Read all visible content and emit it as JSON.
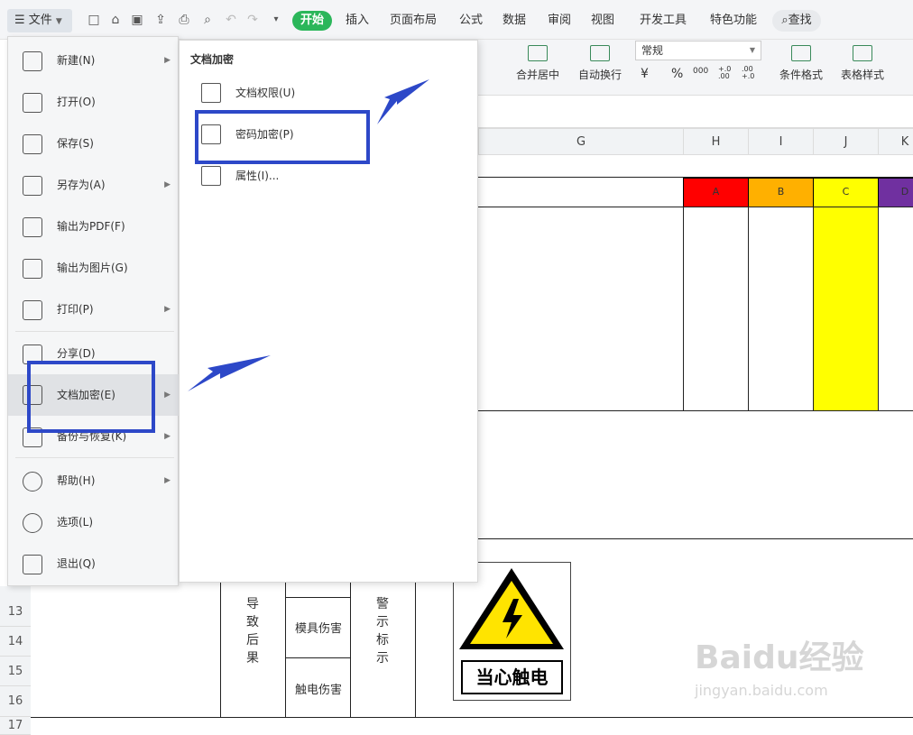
{
  "toolbar": {
    "file_label": "文件",
    "tabs": [
      "开始",
      "插入",
      "页面布局",
      "公式",
      "数据",
      "审阅",
      "视图",
      "开发工具",
      "特色功能"
    ],
    "search_label": "查找"
  },
  "ribbon": {
    "merge_label": "合并居中",
    "wrap_label": "自动换行",
    "number_format": "常规",
    "currency_symbol": "¥",
    "percent_symbol": "%",
    "thousands": "000",
    "dec_up": "+.0 .00",
    "dec_down": ".00 +.0",
    "cond_format": "条件格式",
    "table_style": "表格样式"
  },
  "file_menu": {
    "items": [
      {
        "label": "新建(N)",
        "icon": "new-file-icon",
        "arrow": true
      },
      {
        "label": "打开(O)",
        "icon": "folder-open-icon",
        "arrow": false
      },
      {
        "label": "保存(S)",
        "icon": "save-icon",
        "arrow": false
      },
      {
        "label": "另存为(A)",
        "icon": "save-as-icon",
        "arrow": true
      },
      {
        "label": "输出为PDF(F)",
        "icon": "pdf-export-icon",
        "arrow": false
      },
      {
        "label": "输出为图片(G)",
        "icon": "image-export-icon",
        "arrow": false
      },
      {
        "label": "打印(P)",
        "icon": "print-icon",
        "arrow": true
      },
      {
        "label": "分享(D)",
        "icon": "share-icon",
        "arrow": false
      },
      {
        "label": "文档加密(E)",
        "icon": "document-encrypt-icon",
        "arrow": true
      },
      {
        "label": "备份与恢复(K)",
        "icon": "backup-icon",
        "arrow": true
      },
      {
        "label": "帮助(H)",
        "icon": "help-icon",
        "arrow": true
      },
      {
        "label": "选项(L)",
        "icon": "gear-icon",
        "arrow": false
      },
      {
        "label": "退出(Q)",
        "icon": "exit-icon",
        "arrow": false
      }
    ]
  },
  "submenu": {
    "title": "文档加密",
    "items": [
      {
        "label": "文档权限(U)",
        "icon": "document-permission-icon"
      },
      {
        "label": "密码加密(P)",
        "icon": "password-lock-icon"
      },
      {
        "label": "属性(I)...",
        "icon": "properties-icon"
      }
    ]
  },
  "sheet": {
    "columns": [
      "G",
      "H",
      "I",
      "J",
      "K"
    ],
    "rows": [
      "13",
      "14",
      "15",
      "16",
      "17"
    ],
    "legend": [
      {
        "label": "A",
        "color": "#ff0000"
      },
      {
        "label": "B",
        "color": "#ffb000"
      },
      {
        "label": "C",
        "color": "#ffff00"
      },
      {
        "label": "D",
        "color": "#7030a0"
      }
    ],
    "result_label": "导致后果",
    "warning_label": "警示标示",
    "harm1": "模具伤害",
    "harm2": "触电伤害",
    "sign_text": "当心触电"
  },
  "watermark": {
    "main": "Baidu经验",
    "sub": "jingyan.baidu.com"
  },
  "colors": {
    "accent_green": "#2bb65a",
    "highlight_blue": "#2d48c8"
  }
}
